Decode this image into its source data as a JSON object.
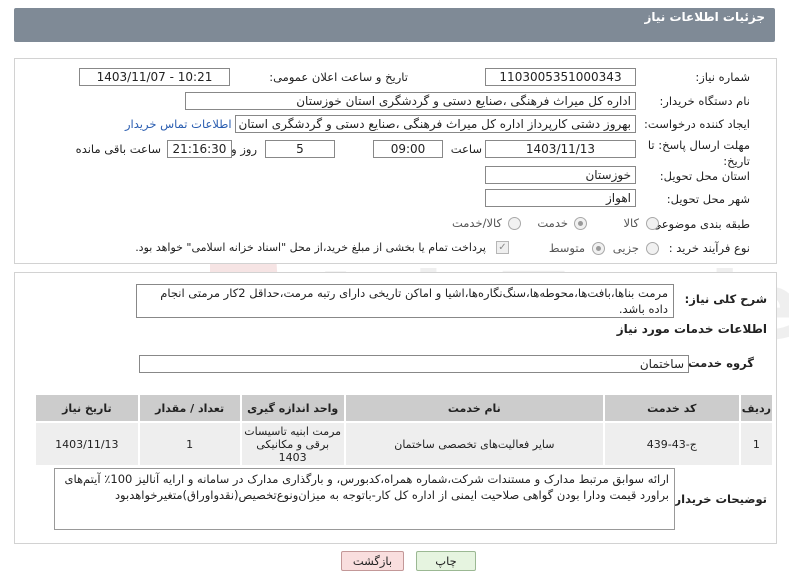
{
  "header": {
    "title": "جزئیات اطلاعات نیاز"
  },
  "form": {
    "need_number": {
      "label": "شماره نیاز:",
      "value": "1103005351000343"
    },
    "announce_datetime": {
      "label": "تاریخ و ساعت اعلان عمومی:",
      "value": "1403/11/07 - 10:21"
    },
    "buyer_org": {
      "label": "نام دستگاه خریدار:",
      "value": "اداره کل میراث فرهنگی ،صنایع دستی و گردشگری استان خوزستان"
    },
    "requester": {
      "label": "ایجاد کننده درخواست:",
      "value": "بهروز دشتی کارپرداز اداره کل میراث فرهنگی ،صنایع دستی و گردشگری استان خوزستان",
      "contact_link": "اطلاعات تماس خریدار"
    },
    "deadline": {
      "label": "مهلت ارسال پاسخ: تا تاریخ:",
      "date": "1403/11/13",
      "time_label": "ساعت",
      "time": "09:00",
      "days": "5",
      "days_label": "روز و",
      "remaining": "21:16:30",
      "remaining_label": "ساعت باقی مانده"
    },
    "province": {
      "label": "استان محل تحویل:",
      "value": "خوزستان"
    },
    "city": {
      "label": "شهر محل تحویل:",
      "value": "اهواز"
    },
    "category": {
      "label": "طبقه بندی موضوعی:",
      "options": [
        "کالا",
        "خدمت",
        "کالا/خدمت"
      ],
      "selected": "خدمت"
    },
    "purchase_process": {
      "label": "نوع فرآیند خرید :",
      "options": [
        "جزیی",
        "متوسط"
      ],
      "selected": "متوسط",
      "note": "پرداخت تمام یا بخشی از مبلغ خرید،از محل \"اسناد خزانه اسلامی\" خواهد بود."
    }
  },
  "details": {
    "summary_label": "شرح کلی نیاز:",
    "summary_value": "مرمت بناها،بافت‌ها،محوطه‌ها،سنگ‌نگاره‌ها،اشیا و اماکن تاریخی دارای رتبه مرمت،حداقل 2کار مرمتی انجام داده باشد.",
    "services_title": "اطلاعات خدمات مورد نیاز",
    "service_group_label": "گروه خدمت:",
    "service_group_value": "ساختمان",
    "table": {
      "headers": [
        "ردیف",
        "کد خدمت",
        "نام خدمت",
        "واحد اندازه گیری",
        "تعداد / مقدار",
        "تاریخ نیاز"
      ],
      "rows": [
        [
          "1",
          "ج-43-439",
          "سایر فعالیت‌های تخصصی ساختمان",
          "مرمت ابنیه تاسیسات برقی و مکانیکی 1403",
          "1",
          "1403/11/13"
        ]
      ]
    },
    "buyer_notes_label": "توضیحات خریدار:",
    "buyer_notes_value": "ارائه سوابق مرتبط مدارک و مستندات شرکت،شماره همراه،کدبورس، و بارگذاری مدارک در سامانه و ارایه آنالیز 100٪ آیتم‌های براورد قیمت ودارا بودن گواهی صلاحیت ایمنی از اداره کل کار-باتوجه به میزان‌ونوع‌تخصیص(نقدواوراق)متغیرخواهدبود"
  },
  "buttons": {
    "print": "چاپ",
    "back": "بازگشت"
  },
  "watermark": {
    "text": "AriaTender.neT"
  }
}
